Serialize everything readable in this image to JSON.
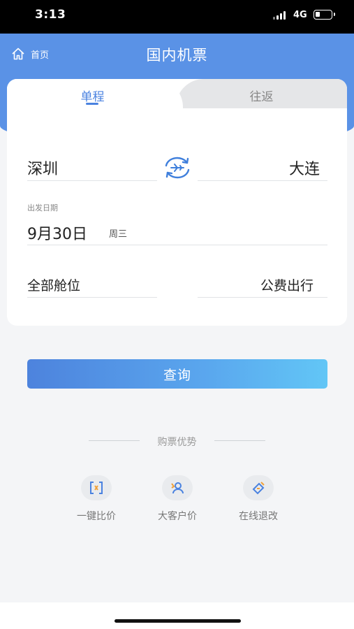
{
  "status_bar": {
    "time": "3:13",
    "network": "4G"
  },
  "header": {
    "home_label": "首页",
    "title": "国内机票"
  },
  "tabs": {
    "single": "单程",
    "round_trip": "往返"
  },
  "route": {
    "from": "深圳",
    "to": "大连"
  },
  "date": {
    "label": "出发日期",
    "value": "9月30日",
    "weekday": "周三"
  },
  "options": {
    "cabin": "全部舱位",
    "trip_type": "公费出行"
  },
  "search_button": "查询",
  "advantages": {
    "title": "购票优势",
    "items": [
      {
        "label": "一键比价",
        "icon": "compare-price-icon"
      },
      {
        "label": "大客户价",
        "icon": "vip-customer-icon"
      },
      {
        "label": "在线退改",
        "icon": "online-refund-icon"
      }
    ]
  },
  "colors": {
    "primary": "#5a92e6",
    "accent": "#4a82e0",
    "button_start": "#4d83dd",
    "button_end": "#62c6f6"
  }
}
